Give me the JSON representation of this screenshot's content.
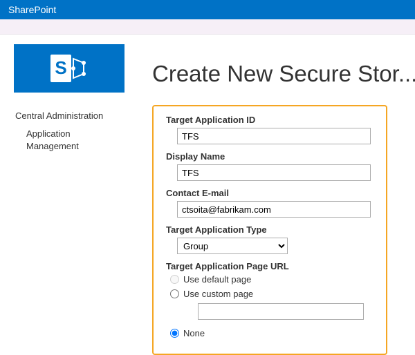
{
  "header": {
    "brand": "SharePoint"
  },
  "logo": {
    "letter": "S"
  },
  "nav": {
    "root": "Central Administration",
    "child": "Application Management"
  },
  "page": {
    "title": "Create New Secure Stor..."
  },
  "form": {
    "target_id": {
      "label": "Target Application ID",
      "value": "TFS"
    },
    "display_name": {
      "label": "Display Name",
      "value": "TFS"
    },
    "contact_email": {
      "label": "Contact E-mail",
      "value": "ctsoita@fabrikam.com"
    },
    "app_type": {
      "label": "Target Application Type",
      "value": "Group"
    },
    "page_url": {
      "label": "Target Application Page URL",
      "opt_default": "Use default page",
      "opt_custom": "Use custom page",
      "custom_value": "",
      "opt_none": "None",
      "selected": "none"
    }
  }
}
